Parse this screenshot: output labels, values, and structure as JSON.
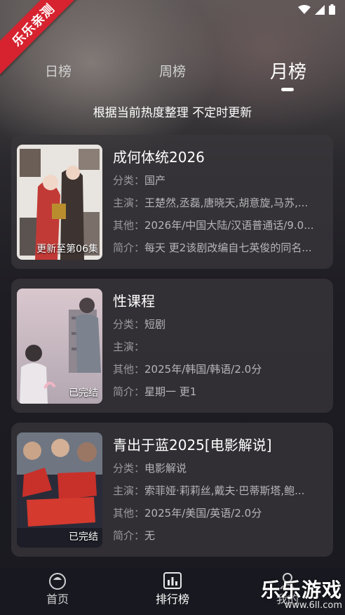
{
  "watermark_corner": "乐乐亲测",
  "tabs": [
    {
      "label": "日榜",
      "active": false
    },
    {
      "label": "周榜",
      "active": false
    },
    {
      "label": "月榜",
      "active": true
    }
  ],
  "subtitle": "根据当前热度整理 不定时更新",
  "items": [
    {
      "title": "成何体统2026",
      "badge": "更新至第06集",
      "category_key": "分类：",
      "category": "国产",
      "cast_key": "主演：",
      "cast": "王楚然,丞磊,唐晓天,胡意旋,马苏,...",
      "other_key": "其他：",
      "other": "2026年/中国大陆/汉语普通话/9.0...",
      "intro_key": "简介：",
      "intro": "每天 更2该剧改编自七英俊的同名...",
      "poster_colors": [
        "#e8e4df",
        "#c23a36",
        "#4a3d3a"
      ]
    },
    {
      "title": "性课程",
      "badge": "已完结",
      "category_key": "分类：",
      "category": "短剧",
      "cast_key": "主演：",
      "cast": "",
      "other_key": "其他：",
      "other": "2025年/韩国/韩语/2.0分",
      "intro_key": "简介：",
      "intro": "星期一 更1",
      "poster_colors": [
        "#d8c6cc",
        "#b7a9b3",
        "#6d6a78"
      ]
    },
    {
      "title": "青出于蓝2025[电影解说]",
      "badge": "已完结",
      "category_key": "分类：",
      "category": "电影解说",
      "cast_key": "主演：",
      "cast": "索菲娅·莉莉丝,戴夫·巴蒂斯塔,鲍...",
      "other_key": "其他：",
      "other": "2025年/美国/英语/2.0分",
      "intro_key": "简介：",
      "intro": "无",
      "poster_colors": [
        "#c8302a",
        "#2a2b38",
        "#9aa3ad"
      ]
    }
  ],
  "nav": [
    {
      "label": "首页",
      "icon": "home-icon"
    },
    {
      "label": "排行榜",
      "icon": "chart-icon"
    },
    {
      "label": "我的",
      "icon": "profile-icon"
    }
  ],
  "watermark": {
    "main": "乐乐游戏",
    "sub": "www.6ll.com"
  }
}
